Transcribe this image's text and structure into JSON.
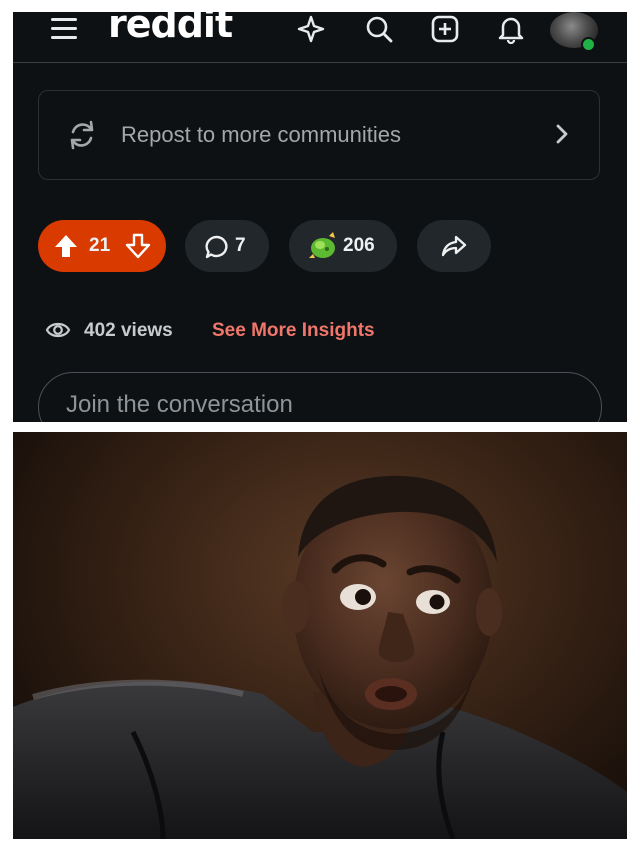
{
  "app": {
    "logo_text": "reddit",
    "top_icons": [
      "menu-icon",
      "ai-sparkle-icon",
      "search-icon",
      "create-post-icon",
      "notification-bell-icon",
      "avatar"
    ]
  },
  "repost": {
    "label": "Repost to more communities",
    "icon": "repost-icon",
    "chevron": "chevron-right-icon"
  },
  "post_actions": {
    "upvotes": "21",
    "comments": "7",
    "awards": "206",
    "vote_color": "#d93a00",
    "share_icon": "share-icon"
  },
  "insights": {
    "views": "402 views",
    "link": "See More Insights",
    "link_color": "#f0766b"
  },
  "comment": {
    "placeholder": "Join the conversation"
  },
  "colors": {
    "background": "#0e1113",
    "pill": "#22272b",
    "text_muted": "#a3a7aa"
  }
}
